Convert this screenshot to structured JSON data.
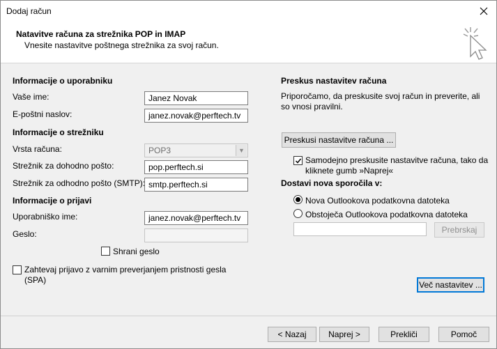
{
  "window": {
    "title": "Dodaj račun"
  },
  "header": {
    "title": "Natavitve računa za strežnika POP in IMAP",
    "subtitle": "Vnesite nastavitve poštnega strežnika za svoj račun.",
    "icon": "pointer-sparkle-icon"
  },
  "user_info": {
    "section": "Informacije o uporabniku",
    "name_label": "Vaše ime:",
    "name_value": "Janez Novak",
    "email_label": "E-poštni naslov:",
    "email_value": "janez.novak@perftech.tv"
  },
  "server_info": {
    "section": "Informacije o strežniku",
    "account_type_label": "Vrsta računa:",
    "account_type_value": "POP3",
    "incoming_label": "Strežnik za dohodno pošto:",
    "incoming_value": "pop.perftech.si",
    "outgoing_label": "Strežnik za odhodno pošto (SMTP):",
    "outgoing_value": "smtp.perftech.si"
  },
  "login_info": {
    "section": "Informacije o prijavi",
    "username_label": "Uporabniško ime:",
    "username_value": "janez.novak@perftech.tv",
    "password_label": "Geslo:",
    "password_value": "",
    "remember_label": "Shrani geslo",
    "remember_checked": false,
    "spa_label": "Zahtevaj prijavo z varnim preverjanjem pristnosti gesla (SPA)",
    "spa_checked": false
  },
  "test_settings": {
    "section": "Preskus nastavitev računa",
    "description": "Priporočamo, da preskusite svoj račun in preverite, ali so vnosi pravilni.",
    "test_button": "Preskusi nastavitve računa ...",
    "auto_test_label": "Samodejno preskusite nastavitve računa, tako da kliknete gumb »Naprej«",
    "auto_test_checked": true
  },
  "delivery": {
    "section": "Dostavi nova sporočila v:",
    "option_new": "Nova Outlookova podatkovna datoteka",
    "option_existing": "Obstoječa Outlookova podatkovna datoteka",
    "selected": "new",
    "path_value": "",
    "browse_button": "Prebrskaj"
  },
  "more_settings_button": "Več nastavitev ...",
  "footer": {
    "back": "< Nazaj",
    "next": "Naprej >",
    "cancel": "Prekliči",
    "help": "Pomoč"
  },
  "colors": {
    "accent": "#0078d7",
    "window_bg": "#f0f0f0",
    "header_bg": "#ffffff"
  }
}
